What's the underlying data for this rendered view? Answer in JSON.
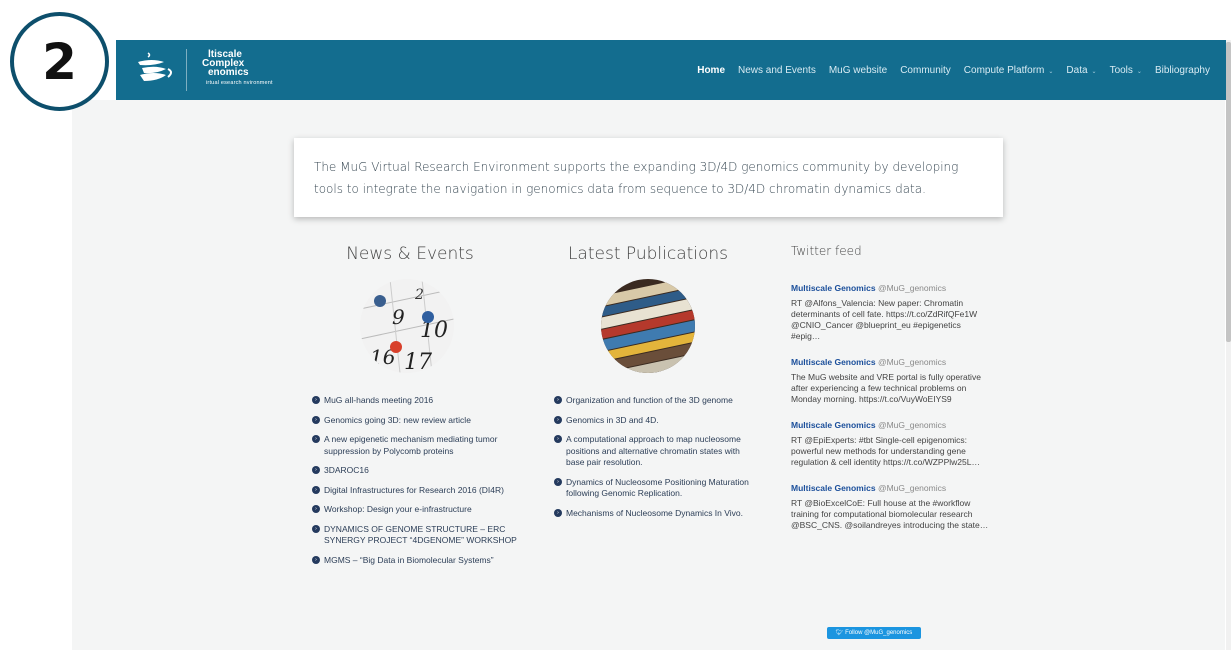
{
  "step_number": "2",
  "brand": {
    "line1": "ltiscale",
    "line2": "Complex",
    "line3": "enomics",
    "line4": "irtual  esearch  nvironment"
  },
  "nav": {
    "items": [
      {
        "label": "Home",
        "active": true,
        "dropdown": false
      },
      {
        "label": "News and Events",
        "active": false,
        "dropdown": false
      },
      {
        "label": "MuG website",
        "active": false,
        "dropdown": false
      },
      {
        "label": "Community",
        "active": false,
        "dropdown": false
      },
      {
        "label": "Compute Platform",
        "active": false,
        "dropdown": true
      },
      {
        "label": "Data",
        "active": false,
        "dropdown": true
      },
      {
        "label": "Tools",
        "active": false,
        "dropdown": true
      },
      {
        "label": "Bibliography",
        "active": false,
        "dropdown": false
      }
    ]
  },
  "intro": {
    "text": "The MuG Virtual Research Environment supports the expanding 3D/4D genomics community by developing tools to integrate the navigation in genomics data from sequence to 3D/4D chromatin dynamics data."
  },
  "news": {
    "title": "News & Events",
    "items": [
      "MuG all-hands meeting 2016",
      "Genomics going 3D: new review article",
      "A new epigenetic mechanism mediating tumor suppression by Polycomb proteins",
      "3DAROC16",
      "Digital Infrastructures for Research 2016 (DI4R)",
      "Workshop: Design your e-infrastructure",
      "DYNAMICS OF GENOME STRUCTURE – ERC SYNERGY PROJECT “4DGENOME” WORKSHOP",
      "MGMS – “Big Data in Biomolecular Systems”"
    ]
  },
  "publications": {
    "title": "Latest Publications",
    "items": [
      "Organization and function of the 3D genome",
      "Genomics in 3D and 4D.",
      "A computational approach to map nucleosome positions and alternative chromatin states with base pair resolution.",
      "Dynamics of Nucleosome Positioning Maturation following Genomic Replication.",
      "Mechanisms of Nucleosome Dynamics In Vivo."
    ]
  },
  "twitter": {
    "title": "Twitter feed",
    "tweets": [
      {
        "name": "Multiscale Genomics",
        "handle": "@MuG_genomics",
        "text": "RT @Alfons_Valencia: New paper: Chromatin determinants of cell fate. https://t.co/ZdRifQFe1W @CNIO_Cancer @blueprint_eu #epigenetics #epig…"
      },
      {
        "name": "Multiscale Genomics",
        "handle": "@MuG_genomics",
        "text": "The MuG website and VRE portal is fully operative after experiencing a few technical problems on Monday morning. https://t.co/VuyWoEIYS9"
      },
      {
        "name": "Multiscale Genomics",
        "handle": "@MuG_genomics",
        "text": "RT @EpiExperts: #tbt Single-cell epigenomics: powerful new methods for understanding gene regulation & cell identity https://t.co/WZPPlw25L…"
      },
      {
        "name": "Multiscale Genomics",
        "handle": "@MuG_genomics",
        "text": "RT @BioExcelCoE: Full house at the #workflow training for computational biomolecular research @BSC_CNS. @soilandreyes introducing the state…"
      }
    ],
    "follow_label": "Follow @MuG_genomics"
  },
  "colors": {
    "navbar": "#136d8f",
    "link_blue": "#1b4f9b",
    "twitter_blue": "#1b95e0"
  }
}
